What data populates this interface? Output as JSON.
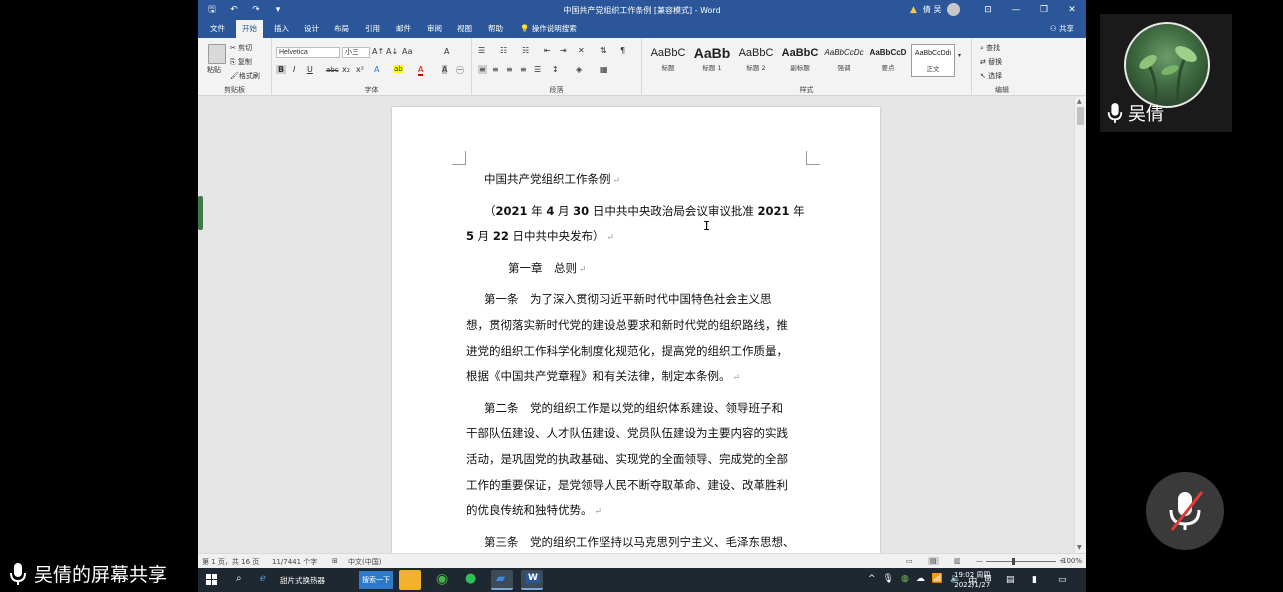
{
  "word": {
    "title": "中国共产党组织工作条例 [兼容模式] - Word",
    "user_name": "倩 吴",
    "qat": {
      "save": "🖫",
      "undo": "↶",
      "redo": "↷",
      "customize": "▾"
    },
    "win_buttons": {
      "ribbon_options": "⊡",
      "minimize": "—",
      "restore": "❐",
      "close": "✕"
    },
    "menu": {
      "tabs": [
        "文件",
        "开始",
        "插入",
        "设计",
        "布局",
        "引用",
        "邮件",
        "审阅",
        "视图",
        "帮助"
      ],
      "active_tab": "开始",
      "tell_me": "操作说明搜索",
      "share": "共享"
    },
    "ribbon": {
      "clipboard": {
        "label": "剪贴板",
        "paste": "粘贴",
        "cut": "剪切",
        "copy": "复制",
        "format_painter": "格式刷"
      },
      "font": {
        "label": "字体",
        "font_name": "Helvetica",
        "font_size": "小三",
        "grow": "A↑",
        "shrink": "A↓",
        "case": "Aa",
        "clear": "A",
        "bold": "B",
        "italic": "I",
        "underline": "U",
        "strike": "abc",
        "sub": "x₂",
        "sup": "x²",
        "effects": "A",
        "highlight": "ab",
        "color": "A",
        "shade": "A",
        "circle": "㊀"
      },
      "paragraph": {
        "label": "段落"
      },
      "styles": {
        "label": "样式",
        "items": [
          {
            "sample": "AaBbC",
            "name": "标题"
          },
          {
            "sample": "AaBb",
            "name": "标题 1"
          },
          {
            "sample": "AaBbC",
            "name": "标题 2"
          },
          {
            "sample": "AaBbC",
            "name": "副标题"
          },
          {
            "sample": "AaBbCcDc",
            "name": "强调"
          },
          {
            "sample": "AaBbCcD",
            "name": "要点"
          },
          {
            "sample": "AaBbCcDdi",
            "name": "正文"
          }
        ]
      },
      "editing": {
        "label": "编辑",
        "find": "查找",
        "replace": "替换",
        "select": "选择"
      }
    },
    "document": {
      "title_line": "中国共产党组织工作条例",
      "subtitle_line1_pre": "（",
      "subtitle_year": "2021",
      "subtitle_line1_a": " 年 ",
      "subtitle_month": "4",
      "subtitle_line1_b": " 月 ",
      "subtitle_day": "30",
      "subtitle_line1_c": " 日中共中央政治局会议审议批准 ",
      "subtitle_year2": "2021",
      "subtitle_line1_d": " 年",
      "subtitle_month2": "5",
      "subtitle_line2_a": " 月 ",
      "subtitle_day2": "22",
      "subtitle_line2_b": " 日中共中央发布）",
      "chapter": "第一章　总则",
      "art1": [
        "第一条　为了深入贯彻习近平新时代中国特色社会主义思",
        "想，贯彻落实新时代党的建设总要求和新时代党的组织路线，推",
        "进党的组织工作科学化制度化规范化，提高党的组织工作质量，",
        "根据《中国共产党章程》和有关法律，制定本条例。"
      ],
      "art2": [
        "第二条　党的组织工作是以党的组织体系建设、领导班子和",
        "干部队伍建设、人才队伍建设、党员队伍建设为主要内容的实践",
        "活动，是巩固党的执政基础、实现党的全面领导、完成党的全部",
        "工作的重要保证，是党领导人民不断夺取革命、建设、改革胜利",
        "的优良传统和独特优势。"
      ],
      "art3": [
        "第三条　党的组织工作坚持以马克思列宁主义、毛泽东思想、"
      ],
      "para_mark": "↵"
    },
    "status": {
      "page": "第 1 页，共 16 页",
      "words": "11/7441 个字",
      "lang": "中文(中国)",
      "zoom": "100%"
    }
  },
  "taskbar": {
    "ie_label": "甜片式换热器",
    "search_button": "搜索一下",
    "time": "19:02 周四",
    "date": "2022/1/27",
    "ime": "中"
  },
  "overlay": {
    "share_label": "吴倩的屏幕共享",
    "participant_name": "吴倩"
  }
}
